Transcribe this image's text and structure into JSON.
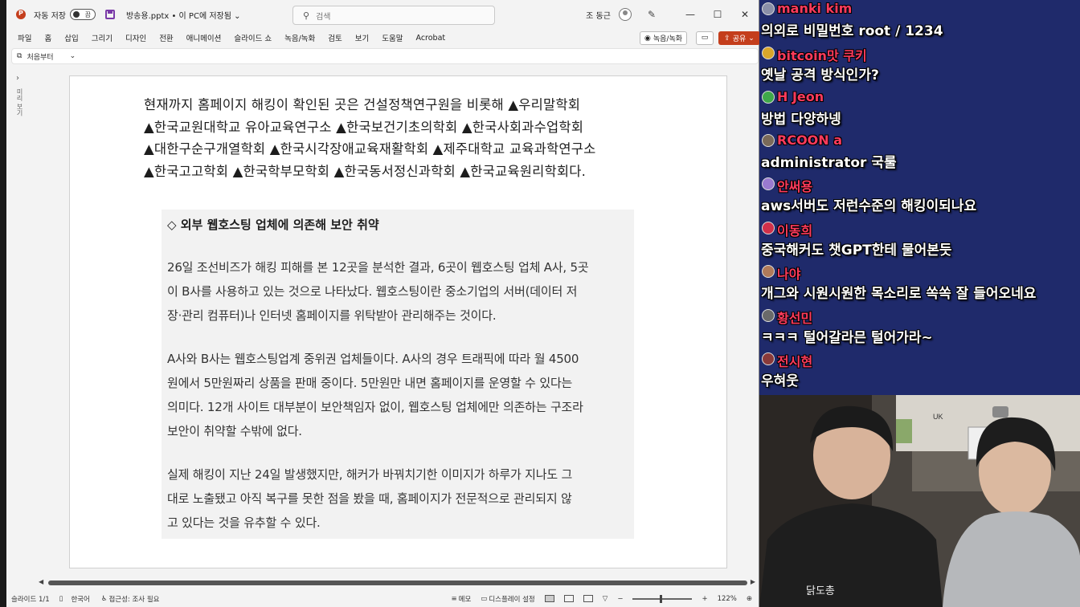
{
  "window": {
    "autosave_label": "자동 저장",
    "autosave_state": "끔",
    "doc_title": "방송용.pptx • 이 PC에 저장됨 ⌄",
    "search_placeholder": "검색",
    "user_name": "조 동근"
  },
  "menu": {
    "items": [
      "파일",
      "홈",
      "삽입",
      "그리기",
      "디자인",
      "전환",
      "애니메이션",
      "슬라이드 쇼",
      "녹음/녹화",
      "검토",
      "보기",
      "도움말",
      "Acrobat"
    ],
    "record_label": "녹음/녹화",
    "share_label": "공유"
  },
  "quickbar": {
    "from_start_label": "처음부터"
  },
  "thumbpane": {
    "vertical_label": "미리 보기"
  },
  "slide": {
    "lead_lines": [
      "현재까지 홈페이지 해킹이 확인된 곳은 건설정책연구원을 비롯해 ▲우리말학회",
      "▲한국교원대학교 유아교육연구소 ▲한국보건기초의학회 ▲한국사회과수업학회",
      "▲대한구순구개열학회 ▲한국시각장애교육재활학회 ▲제주대학교 교육과학연구소",
      "▲한국고고학회 ▲한국학부모학회 ▲한국동서정신과학회 ▲한국교육원리학회다."
    ],
    "article_heading": "◇ 외부 웹호스팅 업체에 의존해 보안 취약",
    "paragraphs": [
      [
        "26일 조선비즈가 해킹 피해를 본 12곳을 분석한 결과, 6곳이 웹호스팅 업체 A사, 5곳",
        "이 B사를 사용하고 있는 것으로 나타났다. 웹호스팅이란 중소기업의 서버(데이터 저",
        "장·관리 컴퓨터)나 인터넷 홈페이지를 위탁받아 관리해주는 것이다."
      ],
      [
        "A사와 B사는 웹호스팅업계 중위권 업체들이다. A사의 경우 트래픽에 따라 월 4500",
        "원에서 5만원짜리 상품을 판매 중이다. 5만원만 내면 홈페이지를 운영할 수 있다는",
        "의미다. 12개 사이트 대부분이 보안책임자 없이, 웹호스팅 업체에만 의존하는 구조라",
        "보안이 취약할 수밖에 없다."
      ],
      [
        "실제 해킹이 지난 24일 발생했지만, 해커가 바꿔치기한 이미지가 하루가 지나도 그",
        "대로 노출됐고 아직 복구를 못한 점을 봤을 때, 홈페이지가 전문적으로 관리되지 않",
        "고 있다는 것을 유추할 수 있다."
      ]
    ]
  },
  "statusbar": {
    "slide_indicator": "슬라이드 1/1",
    "language": "한국어",
    "accessibility": "접근성: 조사 필요",
    "notes_label": "메모",
    "display_settings_label": "디스플레이 설정",
    "zoom_level": "122%"
  },
  "chat": {
    "messages": [
      {
        "name": "manki kim",
        "text": "의외로 비밀번호 root / 1234",
        "name_color": "#ff3b5c",
        "avatar_color": "#8a8fa8"
      },
      {
        "name": "bitcoin맛 쿠키",
        "text": "옛날 공격 방식인가?",
        "name_color": "#ff3b5c",
        "avatar_color": "#d9a62b"
      },
      {
        "name": "H Jeon",
        "text": "방법 다양하넹",
        "name_color": "#ff3b5c",
        "avatar_color": "#3fa84a"
      },
      {
        "name": "RCOON a",
        "text": "administrator 국룰",
        "name_color": "#ff3b5c",
        "avatar_color": "#7a6a5a"
      },
      {
        "name": "안써용",
        "text": "aws서버도 저런수준의 해킹이되나요",
        "name_color": "#ff3b5c",
        "avatar_color": "#9a7ad0"
      },
      {
        "name": "이동희",
        "text": "중국해커도 챗GPT한테 물어본듯",
        "name_color": "#ff3b5c",
        "avatar_color": "#d0304a"
      },
      {
        "name": "나야",
        "text": "개그와 시원시원한 목소리로 쏙쏙 잘 들어오네요",
        "name_color": "#ff3b5c",
        "avatar_color": "#b07a5a"
      },
      {
        "name": "황선민",
        "text": "ㅋㅋㅋ 털어갈라믄 털어가라~",
        "name_color": "#ff3b5c",
        "avatar_color": "#6a6a6a"
      },
      {
        "name": "전시현",
        "text": "우혀웃",
        "name_color": "#ff3b5c",
        "avatar_color": "#8a3a3a"
      }
    ]
  },
  "webcam": {
    "shirt_text": "닭도총",
    "sign_text": "UK"
  }
}
